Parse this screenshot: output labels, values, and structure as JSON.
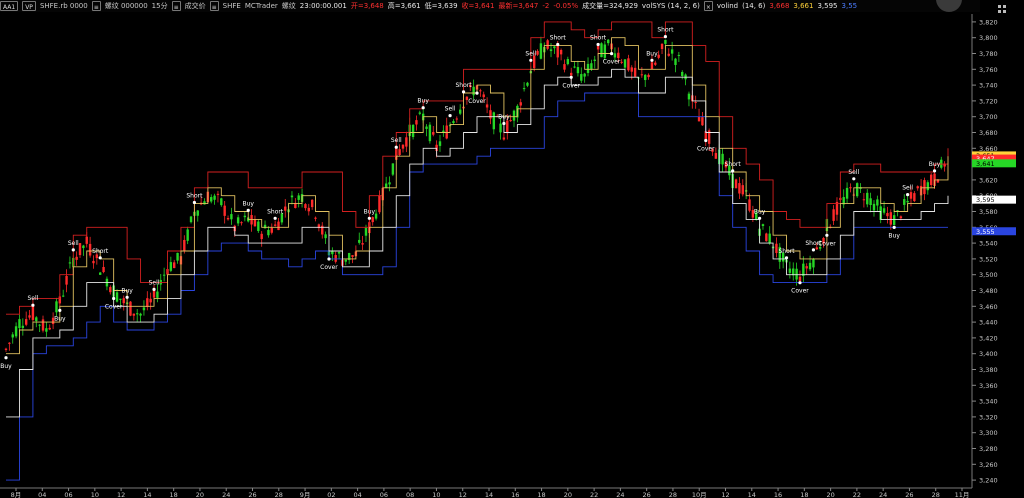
{
  "toolbar": {
    "btn_aa": "AA1",
    "btn_vp": "VP",
    "symbol": "SHFE.rb 0000",
    "chk1": "≡",
    "name": "螺纹 000000",
    "interval": "15分",
    "chk2": "≡",
    "type": "成交价",
    "chk3": "≡",
    "source": "SHFE",
    "feed": "MCTrader",
    "label": "螺纹",
    "time": "23:00:00.001",
    "open": "开=3,648",
    "high": "高=3,661",
    "low": "低=3,639",
    "close": "收=3,641",
    "change": "最新=3,647",
    "chg2": "-2",
    "pct": "-0.05%",
    "volume": "成交量=324,929",
    "ind1": "volSYS (14, 2, 6)",
    "chk4": "×",
    "ind2": "volind",
    "ind2_params": "(14, 6)",
    "ind2_v1": "3,668",
    "ind2_v2": "3,661",
    "ind2_v3": "3,595",
    "ind2_v4": "3,55"
  },
  "corner_icon": "grid-icon",
  "colors": {
    "background": "#000000",
    "grid": "#3a3a3a",
    "up": "#ff2a2a",
    "down": "#26d726",
    "red_band": "#d42020",
    "blue_band": "#2a45e0",
    "yellow_band": "#e0c060",
    "white_band": "#e6e6e6"
  },
  "chart_data": {
    "type": "line",
    "title": "",
    "ylim": [
      3230,
      3830
    ],
    "yticks": [
      "3,240",
      "3,260",
      "3,280",
      "3,300",
      "3,320",
      "3,340",
      "3,360",
      "3,380",
      "3,400",
      "3,420",
      "3,440",
      "3,460",
      "3,480",
      "3,500",
      "3,520",
      "3,540",
      "3,560",
      "3,580",
      "3,600",
      "3,620",
      "3,640",
      "3,660",
      "3,680",
      "3,700",
      "3,720",
      "3,740",
      "3,760",
      "3,780",
      "3,800",
      "3,820"
    ],
    "xticks": [
      "8月",
      "04",
      "06",
      "10",
      "12",
      "14",
      "18",
      "20",
      "24",
      "26",
      "28",
      "9月",
      "02",
      "04",
      "06",
      "08",
      "10",
      "12",
      "14",
      "16",
      "18",
      "20",
      "22",
      "24",
      "26",
      "28",
      "10月",
      "12",
      "14",
      "16",
      "18",
      "20",
      "22",
      "24",
      "26",
      "28",
      "11月"
    ],
    "series": [
      {
        "name": "close",
        "color": "#ffffff",
        "values": [
          3405,
          3440,
          3450,
          3430,
          3465,
          3520,
          3540,
          3510,
          3480,
          3460,
          3450,
          3470,
          3510,
          3520,
          3580,
          3600,
          3590,
          3560,
          3570,
          3555,
          3560,
          3590,
          3600,
          3580,
          3530,
          3520,
          3525,
          3560,
          3600,
          3650,
          3680,
          3700,
          3660,
          3690,
          3720,
          3740,
          3700,
          3680,
          3710,
          3760,
          3790,
          3780,
          3760,
          3750,
          3780,
          3790,
          3770,
          3745,
          3760,
          3790,
          3770,
          3720,
          3680,
          3650,
          3620,
          3600,
          3560,
          3540,
          3510,
          3500,
          3520,
          3560,
          3590,
          3610,
          3600,
          3580,
          3570,
          3590,
          3610,
          3620,
          3650
        ]
      },
      {
        "name": "red_band",
        "color": "#d42020",
        "values": [
          3450,
          3460,
          3470,
          3470,
          3500,
          3550,
          3560,
          3560,
          3560,
          3520,
          3490,
          3490,
          3530,
          3560,
          3610,
          3630,
          3630,
          3630,
          3610,
          3610,
          3610,
          3610,
          3630,
          3630,
          3630,
          3580,
          3560,
          3600,
          3650,
          3680,
          3710,
          3720,
          3720,
          3720,
          3760,
          3760,
          3760,
          3760,
          3760,
          3800,
          3820,
          3820,
          3810,
          3800,
          3810,
          3820,
          3820,
          3820,
          3800,
          3820,
          3820,
          3790,
          3770,
          3700,
          3660,
          3640,
          3620,
          3580,
          3570,
          3560,
          3560,
          3590,
          3630,
          3640,
          3640,
          3630,
          3630,
          3630,
          3630,
          3640,
          3660
        ]
      },
      {
        "name": "blue_band",
        "color": "#2a45e0",
        "values": [
          3240,
          3320,
          3400,
          3410,
          3410,
          3420,
          3440,
          3460,
          3440,
          3430,
          3430,
          3440,
          3450,
          3480,
          3500,
          3530,
          3540,
          3540,
          3530,
          3520,
          3520,
          3510,
          3520,
          3530,
          3520,
          3500,
          3500,
          3500,
          3510,
          3560,
          3630,
          3640,
          3640,
          3640,
          3640,
          3650,
          3660,
          3660,
          3660,
          3660,
          3700,
          3720,
          3720,
          3730,
          3730,
          3730,
          3730,
          3700,
          3700,
          3700,
          3700,
          3700,
          3680,
          3600,
          3560,
          3530,
          3500,
          3490,
          3490,
          3490,
          3490,
          3500,
          3520,
          3560,
          3560,
          3560,
          3560,
          3560,
          3560,
          3560,
          3560
        ]
      },
      {
        "name": "yellow_band",
        "color": "#e0c060",
        "values": [
          3400,
          3430,
          3440,
          3440,
          3460,
          3510,
          3530,
          3520,
          3480,
          3460,
          3460,
          3470,
          3500,
          3530,
          3590,
          3610,
          3600,
          3580,
          3570,
          3560,
          3560,
          3590,
          3600,
          3580,
          3550,
          3520,
          3530,
          3560,
          3610,
          3650,
          3680,
          3700,
          3680,
          3690,
          3730,
          3740,
          3730,
          3700,
          3710,
          3760,
          3790,
          3790,
          3770,
          3760,
          3780,
          3800,
          3790,
          3760,
          3760,
          3790,
          3790,
          3740,
          3700,
          3660,
          3630,
          3600,
          3580,
          3550,
          3530,
          3520,
          3520,
          3560,
          3590,
          3610,
          3610,
          3590,
          3580,
          3590,
          3610,
          3620,
          3650
        ]
      },
      {
        "name": "white_band",
        "color": "#e6e6e6",
        "values": [
          3320,
          3380,
          3420,
          3420,
          3430,
          3460,
          3490,
          3490,
          3460,
          3440,
          3440,
          3450,
          3470,
          3500,
          3530,
          3560,
          3560,
          3550,
          3540,
          3540,
          3540,
          3540,
          3560,
          3560,
          3530,
          3510,
          3510,
          3530,
          3560,
          3600,
          3640,
          3660,
          3650,
          3660,
          3680,
          3700,
          3700,
          3680,
          3690,
          3710,
          3740,
          3750,
          3740,
          3740,
          3750,
          3760,
          3750,
          3730,
          3730,
          3750,
          3750,
          3720,
          3680,
          3630,
          3590,
          3570,
          3540,
          3520,
          3500,
          3500,
          3500,
          3520,
          3550,
          3580,
          3580,
          3570,
          3570,
          3570,
          3580,
          3590,
          3600
        ]
      }
    ],
    "signals": [
      {
        "label": "Buy",
        "i": 0,
        "pos": "below"
      },
      {
        "label": "Sell",
        "i": 2,
        "pos": "above"
      },
      {
        "label": "Buy",
        "i": 4,
        "pos": "below"
      },
      {
        "label": "Sell",
        "i": 5,
        "pos": "above"
      },
      {
        "label": "Short",
        "i": 7,
        "pos": "above"
      },
      {
        "label": "Cover",
        "i": 8,
        "pos": "below"
      },
      {
        "label": "Buy",
        "i": 9,
        "pos": "above"
      },
      {
        "label": "Sell",
        "i": 11,
        "pos": "above"
      },
      {
        "label": "Short",
        "i": 14,
        "pos": "above"
      },
      {
        "label": "Buy",
        "i": 18,
        "pos": "above"
      },
      {
        "label": "Short",
        "i": 20,
        "pos": "above"
      },
      {
        "label": "Cover",
        "i": 24,
        "pos": "below"
      },
      {
        "label": "Buy",
        "i": 27,
        "pos": "above"
      },
      {
        "label": "Sell",
        "i": 29,
        "pos": "above"
      },
      {
        "label": "Buy",
        "i": 31,
        "pos": "above"
      },
      {
        "label": "Sell",
        "i": 33,
        "pos": "above"
      },
      {
        "label": "Short",
        "i": 34,
        "pos": "above"
      },
      {
        "label": "Cover",
        "i": 35,
        "pos": "below"
      },
      {
        "label": "Buy",
        "i": 37,
        "pos": "above"
      },
      {
        "label": "Sell",
        "i": 39,
        "pos": "above"
      },
      {
        "label": "Short",
        "i": 41,
        "pos": "above"
      },
      {
        "label": "Cover",
        "i": 42,
        "pos": "below"
      },
      {
        "label": "Short",
        "i": 44,
        "pos": "above"
      },
      {
        "label": "Cover",
        "i": 45,
        "pos": "below"
      },
      {
        "label": "Buy",
        "i": 48,
        "pos": "above"
      },
      {
        "label": "Short",
        "i": 49,
        "pos": "above"
      },
      {
        "label": "Cover",
        "i": 52,
        "pos": "below"
      },
      {
        "label": "Short",
        "i": 54,
        "pos": "above"
      },
      {
        "label": "Buy",
        "i": 56,
        "pos": "above"
      },
      {
        "label": "Short",
        "i": 58,
        "pos": "above"
      },
      {
        "label": "Cover",
        "i": 59,
        "pos": "below"
      },
      {
        "label": "Short",
        "i": 60,
        "pos": "above"
      },
      {
        "label": "Cover",
        "i": 61,
        "pos": "below"
      },
      {
        "label": "Sell",
        "i": 63,
        "pos": "above"
      },
      {
        "label": "Buy",
        "i": 66,
        "pos": "below"
      },
      {
        "label": "Sell",
        "i": 67,
        "pos": "above"
      },
      {
        "label": "Buy",
        "i": 69,
        "pos": "above"
      }
    ],
    "price_tags": [
      {
        "value": 3651,
        "text": "3,651",
        "bg": "#ffd23a",
        "fg": "#000000"
      },
      {
        "value": 3647,
        "text": "3,647",
        "bg": "#ff2a2a",
        "fg": "#ffffff"
      },
      {
        "value": 3641,
        "text": "3,641",
        "bg": "#26d726",
        "fg": "#000000"
      },
      {
        "value": 3595,
        "text": "3,595",
        "bg": "#ffffff",
        "fg": "#000000"
      },
      {
        "value": 3555,
        "text": "3,555",
        "bg": "#2a45e0",
        "fg": "#ffffff"
      }
    ]
  }
}
